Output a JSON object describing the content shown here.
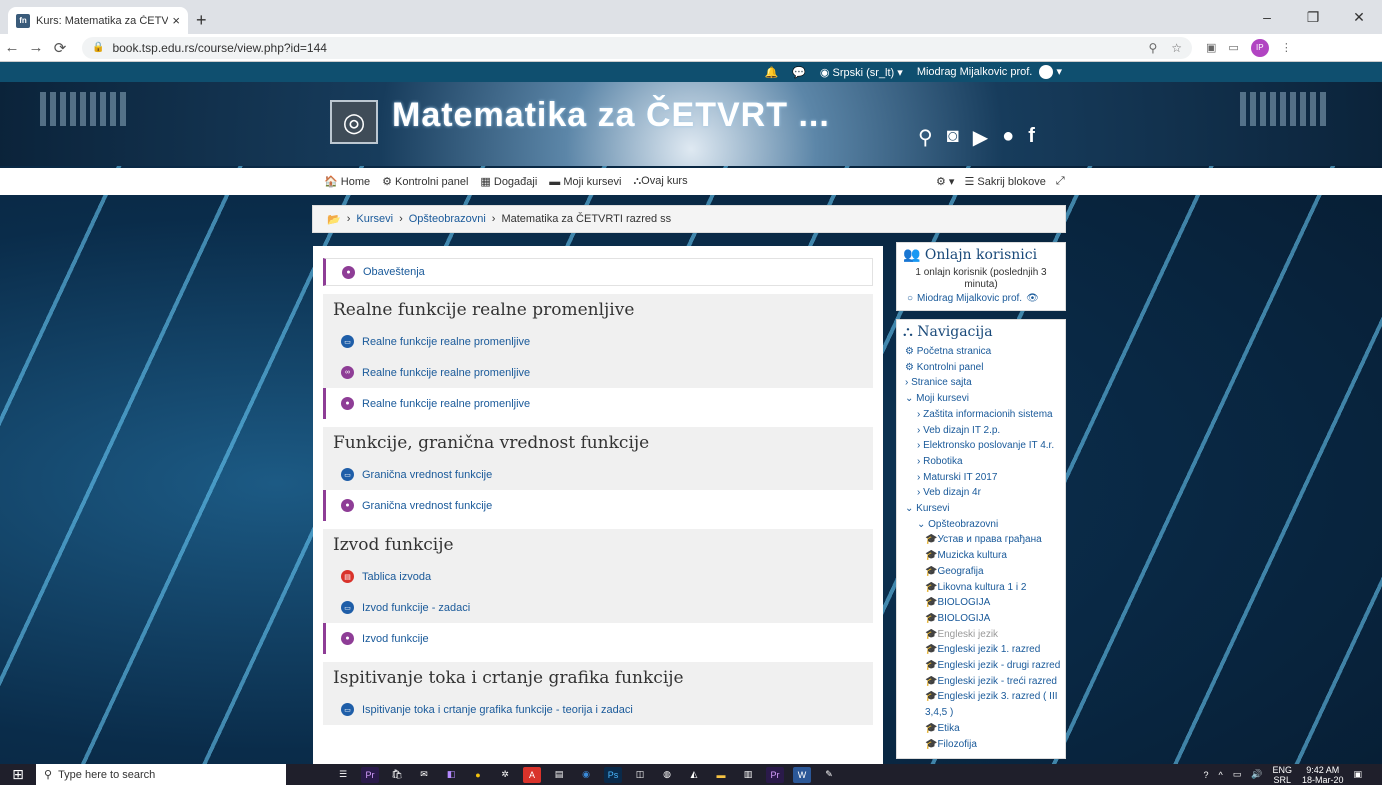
{
  "browser": {
    "tab_title": "Kurs: Matematika za ČETVRTI raz",
    "tab_favicon": "fn",
    "url": "book.tsp.edu.rs/course/view.php?id=144",
    "new_tab": "+",
    "profile_initials": "IP"
  },
  "topbar": {
    "language": "Srpski (sr_lt)",
    "user_name": "Miodrag Mijalkovic prof."
  },
  "banner": {
    "site_title": "Matematika za ČETVRT ..."
  },
  "menu": {
    "items": [
      "Home",
      "Kontrolni panel",
      "Događaji",
      "Moji kursevi",
      "Ovaj kurs"
    ],
    "hide_blocks": "Sakrij blokove"
  },
  "breadcrumb": {
    "items": [
      "Kursevi",
      "Opšteobrazovni",
      "Matematika za ČETVRTI razred ss"
    ]
  },
  "course": {
    "announcements": "Obaveštenja",
    "sections": [
      {
        "title": "Realne funkcije realne promenljive",
        "activities": [
          {
            "label": "Realne funkcije realne promenljive",
            "icon": "folder-icon",
            "color": "#1f5ea8"
          },
          {
            "label": "Realne funkcije realne promenljive",
            "icon": "url-icon",
            "color": "#8e3d96"
          },
          {
            "label": "Realne funkcije realne promenljive",
            "icon": "forum-icon",
            "color": "#8e3d96"
          }
        ]
      },
      {
        "title": "Funkcije, granična vrednost funkcije",
        "activities": [
          {
            "label": "Granična vrednost funkcije",
            "icon": "folder-icon",
            "color": "#1f5ea8"
          },
          {
            "label": "Granična vrednost funkcije",
            "icon": "forum-icon",
            "color": "#8e3d96"
          }
        ]
      },
      {
        "title": "Izvod funkcije",
        "activities": [
          {
            "label": "Tablica izvoda",
            "icon": "pdf-icon",
            "color": "#d9332b"
          },
          {
            "label": "Izvod funkcije - zadaci",
            "icon": "folder-icon",
            "color": "#1f5ea8"
          },
          {
            "label": "Izvod funkcije",
            "icon": "forum-icon",
            "color": "#8e3d96"
          }
        ]
      },
      {
        "title": "Ispitivanje toka i crtanje grafika funkcije",
        "activities": [
          {
            "label": "Ispitivanje toka i crtanje grafika funkcije - teorija i zadaci",
            "icon": "folder-icon",
            "color": "#1f5ea8"
          }
        ]
      }
    ]
  },
  "online_block": {
    "title": "Onlajn korisnici",
    "summary": "1 onlajn korisnik (poslednjih 3 minuta)",
    "user": "Miodrag Mijalkovic prof."
  },
  "navigation_block": {
    "title": "Navigacija",
    "items": [
      {
        "label": "Početna stranica",
        "level": 1
      },
      {
        "label": "Kontrolni panel",
        "level": 1
      },
      {
        "label": "› Stranice sajta",
        "level": 1
      },
      {
        "label": "⌄ Moji kursevi",
        "level": 1
      },
      {
        "label": "› Zaštita informacionih sistema",
        "level": 2
      },
      {
        "label": "› Veb dizajn IT 2.p.",
        "level": 2
      },
      {
        "label": "› Elektronsko poslovanje IT 4.r.",
        "level": 2
      },
      {
        "label": "› Robotika",
        "level": 2
      },
      {
        "label": "› Maturski IT 2017",
        "level": 2
      },
      {
        "label": "› Veb dizajn 4r",
        "level": 2
      },
      {
        "label": "⌄ Kursevi",
        "level": 1
      },
      {
        "label": "⌄ Opšteobrazovni",
        "level": 2
      },
      {
        "label": "Устав и права грађана",
        "level": 3
      },
      {
        "label": "Muzicka kultura",
        "level": 3
      },
      {
        "label": "Geografija",
        "level": 3
      },
      {
        "label": "Likovna kultura 1 i 2",
        "level": 3
      },
      {
        "label": "BIOLOGIJA",
        "level": 3
      },
      {
        "label": "BIOLOGIJA",
        "level": 3
      },
      {
        "label": "Engleski jezik",
        "level": 3,
        "dim": true
      },
      {
        "label": "Engleski jezik 1. razred",
        "level": 3
      },
      {
        "label": "Engleski jezik - drugi razred",
        "level": 3
      },
      {
        "label": "Engleski jezik - treći razred",
        "level": 3
      },
      {
        "label": "Engleski jezik 3. razred ( III 3,4,5 )",
        "level": 3
      },
      {
        "label": "Etika",
        "level": 3
      },
      {
        "label": "Filozofija",
        "level": 3
      }
    ]
  },
  "taskbar": {
    "search_placeholder": "Type here to search",
    "lang": "ENG",
    "region": "SRL",
    "time": "9:42 AM",
    "date": "18-Mar-20"
  },
  "colors": {
    "accent_purple": "#8e3d96",
    "folder_blue": "#1f5ea8",
    "pdf_red": "#d9332b",
    "topbar": "#0f4f6f"
  }
}
